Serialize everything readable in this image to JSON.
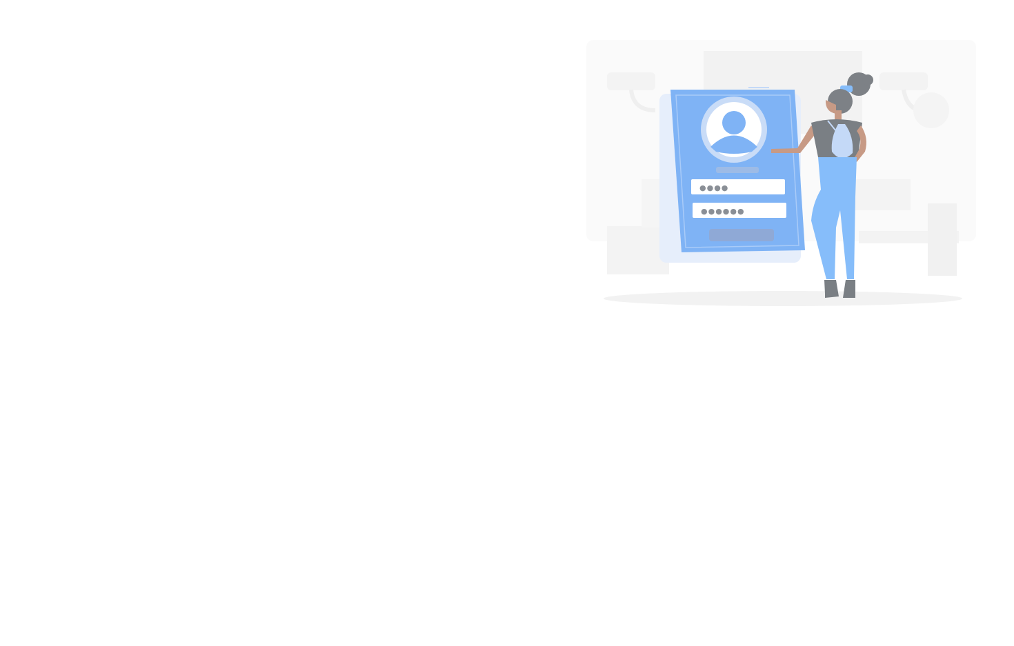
{
  "illustration": {
    "subject": "login-illustration",
    "username_mask": "●●●●",
    "password_mask": "●●●●●●",
    "colors": {
      "phone": "#7fb3f5",
      "phone_shadow": "#e6eefb",
      "field": "#ffffff",
      "mask_dot": "#8a8f96",
      "button": "#8fa9d6",
      "avatar_ring": "#c9dcf7",
      "person_pants": "#86bdfa",
      "person_shirt": "#7a7f84",
      "person_hair": "#7d8186",
      "skin": "#c79a85",
      "background_shapes": "#f3f3f3",
      "floor_shadow": "#f2f2f2"
    }
  }
}
